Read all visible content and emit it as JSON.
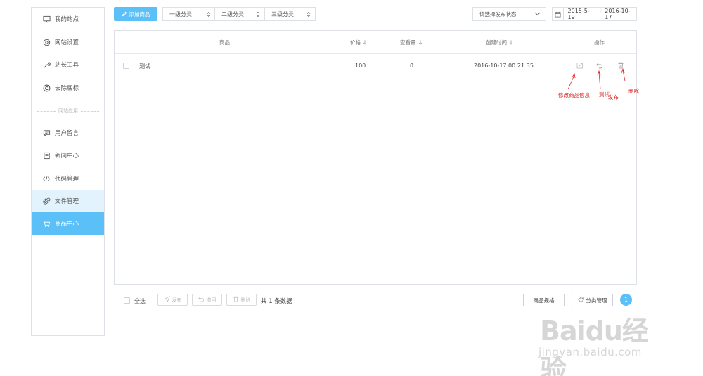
{
  "sidebar": {
    "items": [
      {
        "label": "我的站点",
        "icon": "monitor-icon"
      },
      {
        "label": "网站设置",
        "icon": "gear-icon"
      },
      {
        "label": "站长工具",
        "icon": "wrench-icon"
      },
      {
        "label": "去除底标",
        "icon": "copyright-icon"
      },
      {
        "label": "用户留言",
        "icon": "message-icon"
      },
      {
        "label": "新闻中心",
        "icon": "news-icon"
      },
      {
        "label": "代码管理",
        "icon": "code-icon"
      },
      {
        "label": "文件管理",
        "icon": "paperclip-icon"
      },
      {
        "label": "商品中心",
        "icon": "cart-icon"
      }
    ],
    "divider_label": "网站应用",
    "hover_item": "文件管理",
    "active_item": "商品中心"
  },
  "toolbar": {
    "add_label": "添加商品",
    "category_1": "一级分类",
    "category_2": "二级分类",
    "category_3": "三级分类",
    "status_select": "请选择发布状态",
    "date_start": "2015-5-19",
    "date_sep": "-",
    "date_end": "2016-10-17"
  },
  "table": {
    "headers": {
      "product": "商品",
      "price": "价格",
      "views": "查看量",
      "created": "创建时间",
      "actions": "操作"
    },
    "rows": [
      {
        "name": "测试",
        "price": "100",
        "views": "0",
        "created": "2016-10-17 00:21:35"
      }
    ]
  },
  "annotations": {
    "edit": "修改商品信息",
    "test": "测试",
    "publish": "发布",
    "delete": "删除"
  },
  "footer": {
    "select_all": "全选",
    "publish": "发布",
    "withdraw": "撤回",
    "delete": "删除",
    "total": "共 1 条数据",
    "spec": "商品规格",
    "category_manage": "分类管理",
    "page": "1"
  },
  "watermark": {
    "main": "Baidu经验",
    "sub": "jingyan.baidu.com"
  },
  "colors": {
    "accent": "#5bc0f8",
    "hover": "#e3f3fd",
    "annotation": "#e02020"
  }
}
